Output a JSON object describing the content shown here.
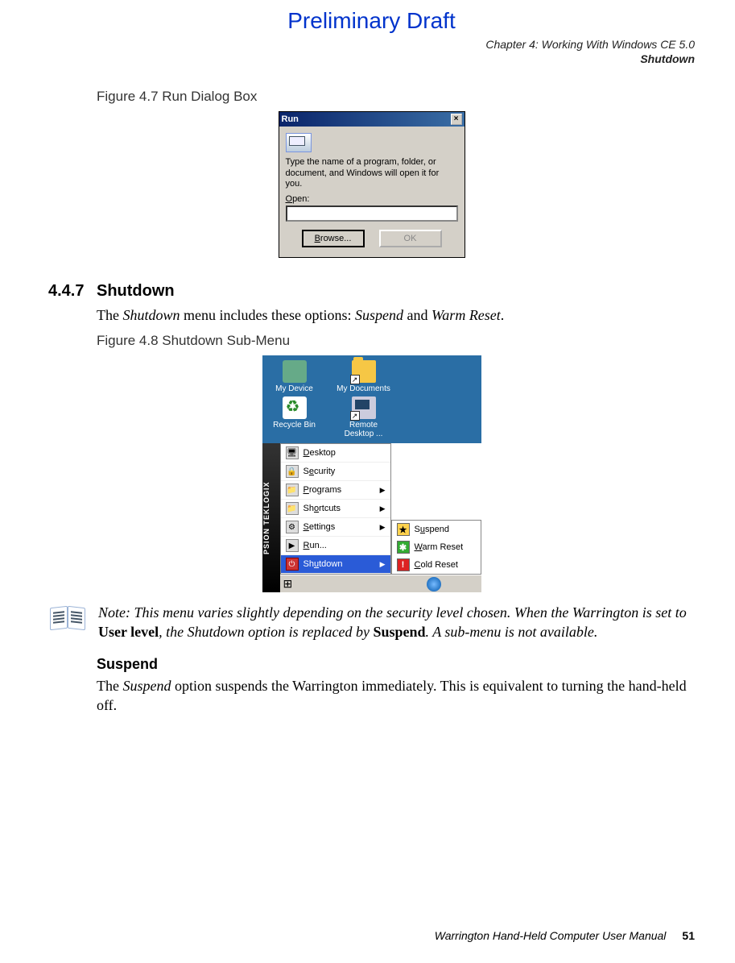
{
  "header": {
    "preliminary": "Preliminary Draft",
    "chapter_line": "Chapter 4:  Working With Windows CE 5.0",
    "section_line": "Shutdown"
  },
  "figure47": {
    "caption": "Figure 4.7  Run Dialog Box",
    "title": "Run",
    "description": "Type the name of a program, folder, or document, and Windows will open it for you.",
    "open_label": "Open:",
    "browse_btn": "Browse...",
    "ok_btn": "OK"
  },
  "section447": {
    "num": "4.4.7",
    "title": "Shutdown",
    "intro_pre": "The ",
    "intro_i1": "Shutdown",
    "intro_mid": " menu includes these options: ",
    "intro_i2": "Suspend",
    "intro_and": " and ",
    "intro_i3": "Warm Reset",
    "intro_end": "."
  },
  "figure48": {
    "caption": "Figure 4.8  Shutdown Sub-Menu"
  },
  "desktop": {
    "my_device": "My Device",
    "my_documents": "My Documents",
    "recycle_bin": "Recycle Bin",
    "remote_desktop": "Remote Desktop ..."
  },
  "sidestrip": "PSION TEKLOGIX",
  "menu": {
    "desktop": "Desktop",
    "security": "Security",
    "programs": "Programs",
    "shortcuts": "Shortcuts",
    "settings": "Settings",
    "run": "Run...",
    "shutdown": "Shutdown"
  },
  "submenu": {
    "suspend": "Suspend",
    "warm_reset": "Warm Reset",
    "cold_reset": "Cold Reset"
  },
  "note": {
    "prefix": "Note: ",
    "t1": "This menu varies slightly depending on the security level chosen. When the Warrington is set to ",
    "b1": "User level",
    "t2": ", the Shutdown option is replaced by ",
    "b2": "Suspend",
    "t3": ". A sub-menu is not available."
  },
  "suspend": {
    "heading": "Suspend",
    "p_pre": "The ",
    "p_i": "Suspend",
    "p_post": " option suspends the Warrington immediately. This is equivalent to turning the hand-held off."
  },
  "footer": {
    "manual": "Warrington Hand-Held Computer User Manual",
    "page": "51"
  }
}
